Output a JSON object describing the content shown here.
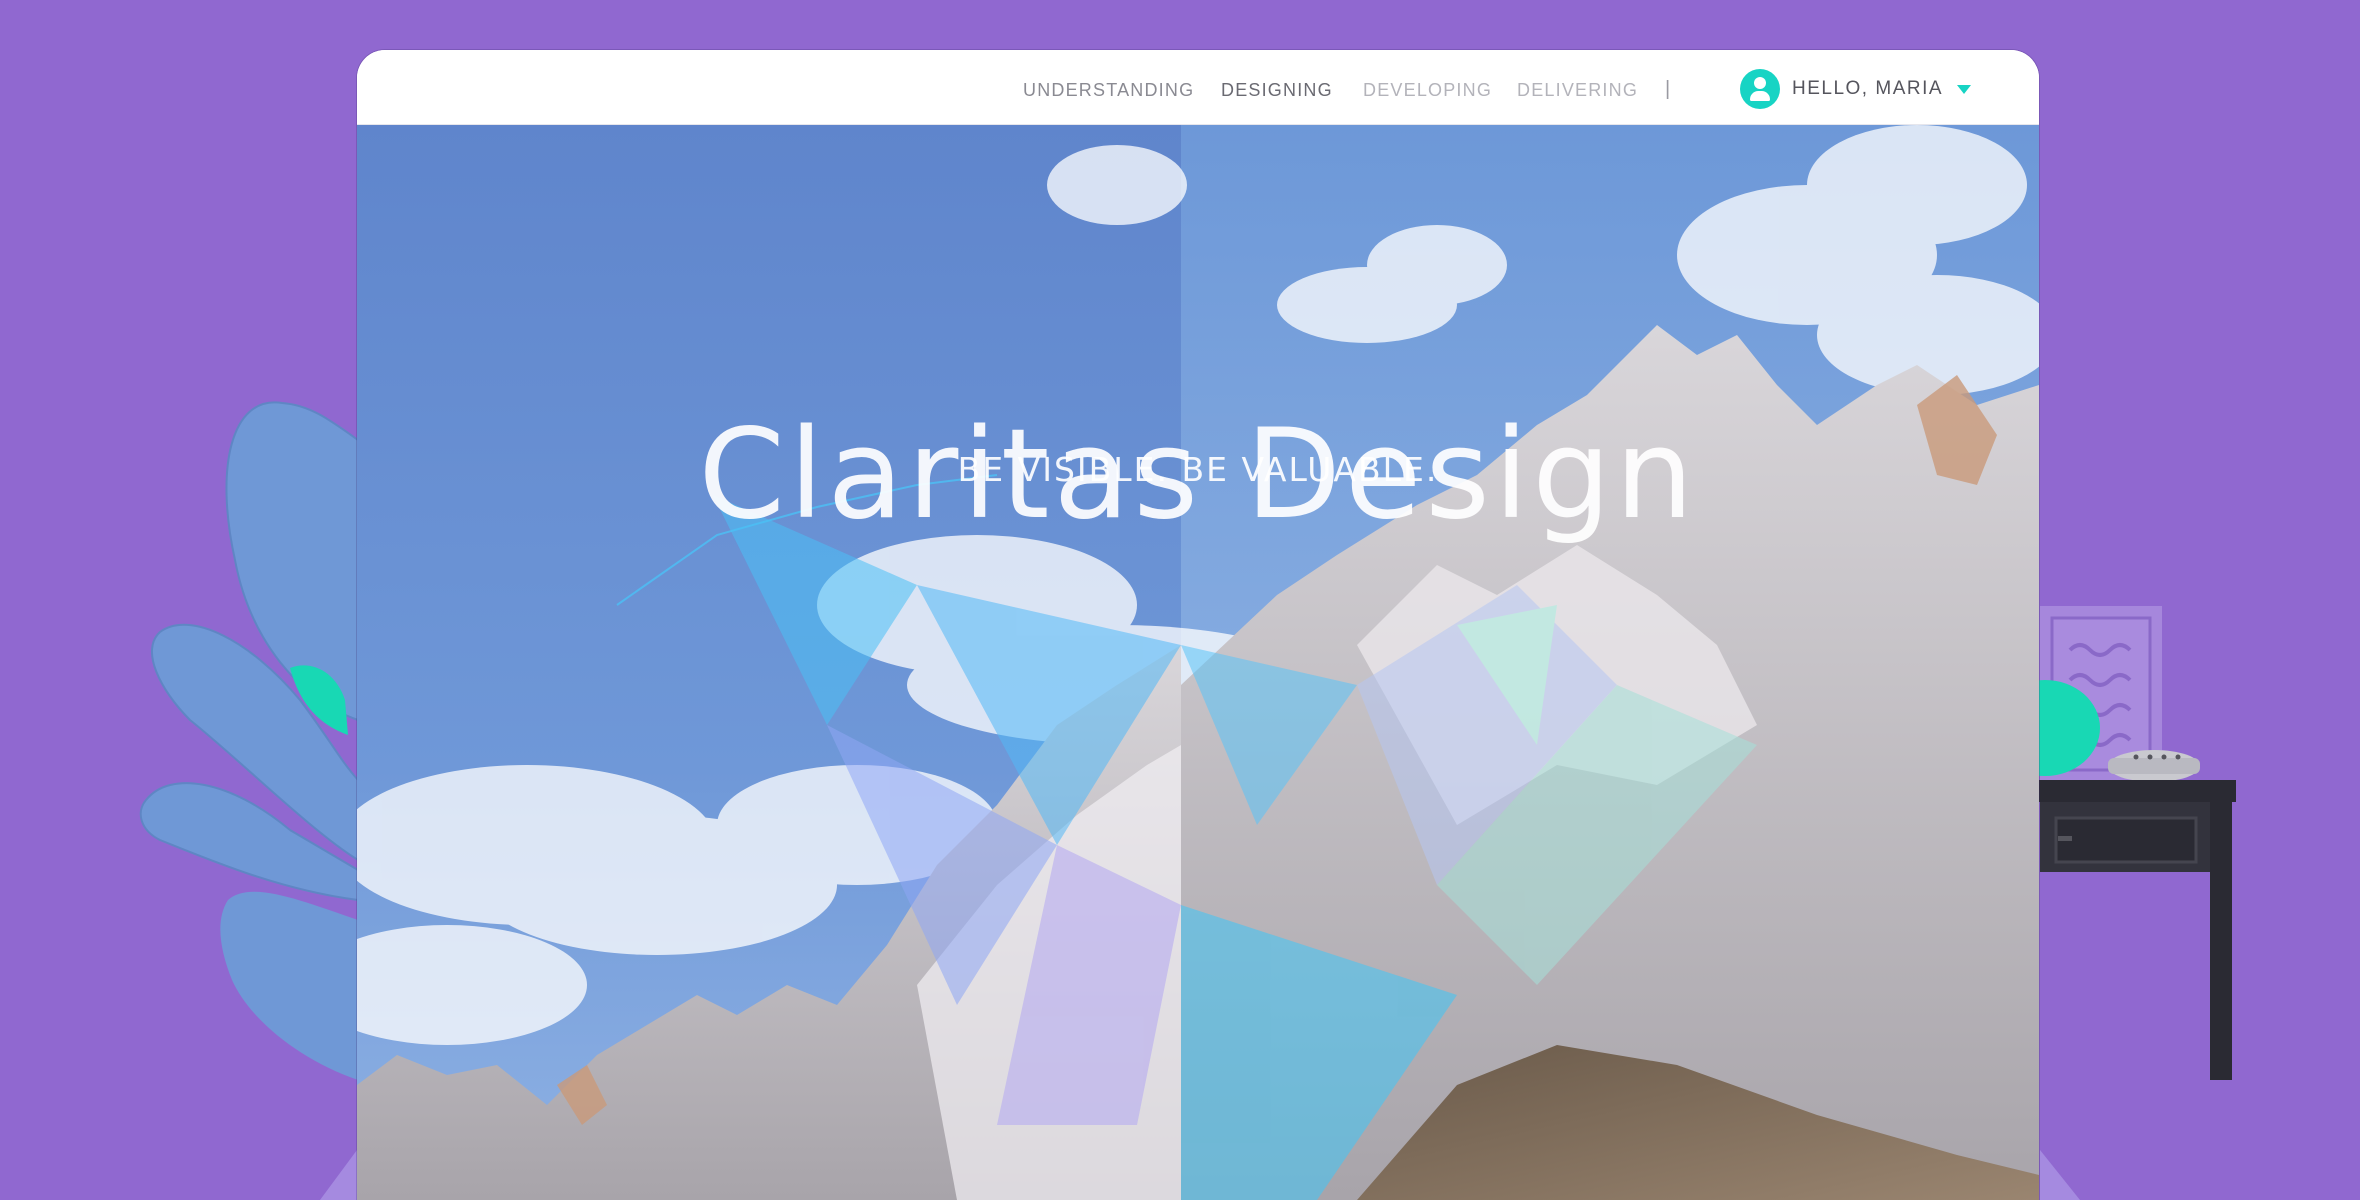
{
  "nav": {
    "items": [
      {
        "label": "UNDERSTANDING",
        "state": "normal"
      },
      {
        "label": "DESIGNING",
        "state": "active"
      },
      {
        "label": "DEVELOPING",
        "state": "muted"
      },
      {
        "label": "DELIVERING",
        "state": "muted"
      }
    ],
    "divider": "|",
    "user": {
      "greeting": "HELLO, MARIA",
      "avatar_icon": "user-icon",
      "dropdown_icon": "caret-down-icon"
    }
  },
  "hero": {
    "title": "Claritas Design",
    "tagline": "BE VISIBLE.  BE VALUABLE."
  },
  "colors": {
    "background": "#9068d0",
    "accent": "#17d4c4",
    "sky": "#6f95d6"
  }
}
